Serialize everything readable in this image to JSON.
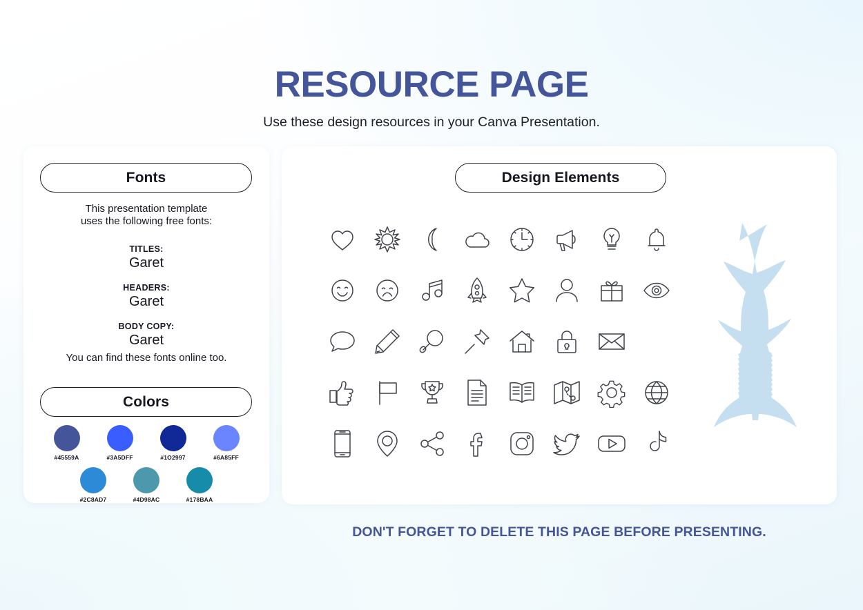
{
  "header": {
    "title": "RESOURCE PAGE",
    "subtitle": "Use these design resources in your Canva Presentation.",
    "title_color": "#45559A"
  },
  "fonts_panel": {
    "pill_label": "Fonts",
    "intro_line1": "This presentation template",
    "intro_line2": "uses the following free fonts:",
    "rows": [
      {
        "role": "TITLES:",
        "family": "Garet"
      },
      {
        "role": "HEADERS:",
        "family": "Garet"
      },
      {
        "role": "BODY COPY:",
        "family": "Garet"
      }
    ],
    "outro": "You can find these fonts online too."
  },
  "colors_panel": {
    "pill_label": "Colors",
    "rows": [
      [
        {
          "hex": "#45559A",
          "label": "#45559A"
        },
        {
          "hex": "#3A5DFF",
          "label": "#3A5DFF"
        },
        {
          "hex": "#102997",
          "label": "#1O2997"
        },
        {
          "hex": "#6A85FF",
          "label": "#6A85FF"
        }
      ],
      [
        {
          "hex": "#2C8AD7",
          "label": "#2C8AD7"
        },
        {
          "hex": "#4D98AC",
          "label": "#4D98AC"
        },
        {
          "hex": "#178BAA",
          "label": "#178BAA"
        }
      ]
    ]
  },
  "elements_panel": {
    "pill_label": "Design Elements",
    "icon_rows": [
      [
        "heart-icon",
        "sun-icon",
        "moon-icon",
        "cloud-icon",
        "clock-icon",
        "megaphone-icon",
        "lightbulb-icon",
        "bell-icon"
      ],
      [
        "smiley-face-icon",
        "sad-face-icon",
        "music-note-icon",
        "rocket-icon",
        "star-icon",
        "person-icon",
        "gift-icon",
        "eye-icon"
      ],
      [
        "speech-bubble-icon",
        "pencil-icon",
        "magnifier-icon",
        "pushpin-icon",
        "house-icon",
        "lock-icon",
        "envelope-icon"
      ],
      [
        "thumbs-up-icon",
        "flag-icon",
        "trophy-icon",
        "document-icon",
        "open-book-icon",
        "map-icon",
        "gear-icon",
        "globe-icon"
      ],
      [
        "phone-icon",
        "location-pin-icon",
        "share-icon",
        "facebook-icon",
        "instagram-icon",
        "twitter-icon",
        "youtube-icon",
        "tiktok-icon"
      ]
    ],
    "decoration": "tuna-fish-silhouette",
    "decoration_color": "#C5DFF0"
  },
  "footer": {
    "note": "DON'T FORGET TO DELETE THIS PAGE BEFORE PRESENTING.",
    "color": "#45559A"
  }
}
